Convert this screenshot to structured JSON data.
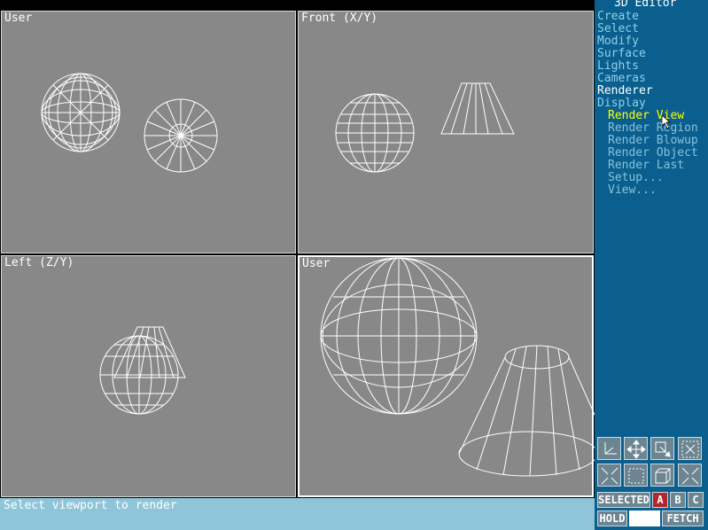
{
  "app": {
    "title": "3D Editor"
  },
  "menu": {
    "items": [
      {
        "label": "Create",
        "active": false
      },
      {
        "label": "Select",
        "active": false
      },
      {
        "label": "Modify",
        "active": false
      },
      {
        "label": "Surface",
        "active": false
      },
      {
        "label": "Lights",
        "active": false
      },
      {
        "label": "Cameras",
        "active": false
      },
      {
        "label": "Renderer",
        "active": true
      },
      {
        "label": "Display",
        "active": false
      }
    ],
    "subitems": [
      {
        "label": "Render View",
        "active": true
      },
      {
        "label": "Render Region",
        "active": false
      },
      {
        "label": "Render Blowup",
        "active": false
      },
      {
        "label": "Render Object",
        "active": false
      },
      {
        "label": "Render Last",
        "active": false
      },
      {
        "label": "Setup...",
        "active": false
      },
      {
        "label": "View...",
        "active": false
      }
    ]
  },
  "viewports": [
    {
      "label": "User"
    },
    {
      "label": "Front (X/Y)"
    },
    {
      "label": "Left (Z/Y)"
    },
    {
      "label": "User"
    }
  ],
  "status": {
    "prompt": "Select viewport to render"
  },
  "buttons": {
    "selected": "SELECTED",
    "a": "A",
    "b": "B",
    "c": "C",
    "hold": "HOLD",
    "fetch": "FETCH"
  },
  "icons": [
    "axis-tripod-icon",
    "pan-icon",
    "zoom-window-icon",
    "zoom-extents-icon",
    "zoom-in-icon",
    "region-icon",
    "view-box-icon",
    "zoom-out-icon"
  ],
  "colors": {
    "sidebar": "#0a5f8e",
    "viewport": "#888888",
    "highlight": "#ffff00",
    "status_bar": "#8fc5d8",
    "button_selected": "#b3262a"
  }
}
